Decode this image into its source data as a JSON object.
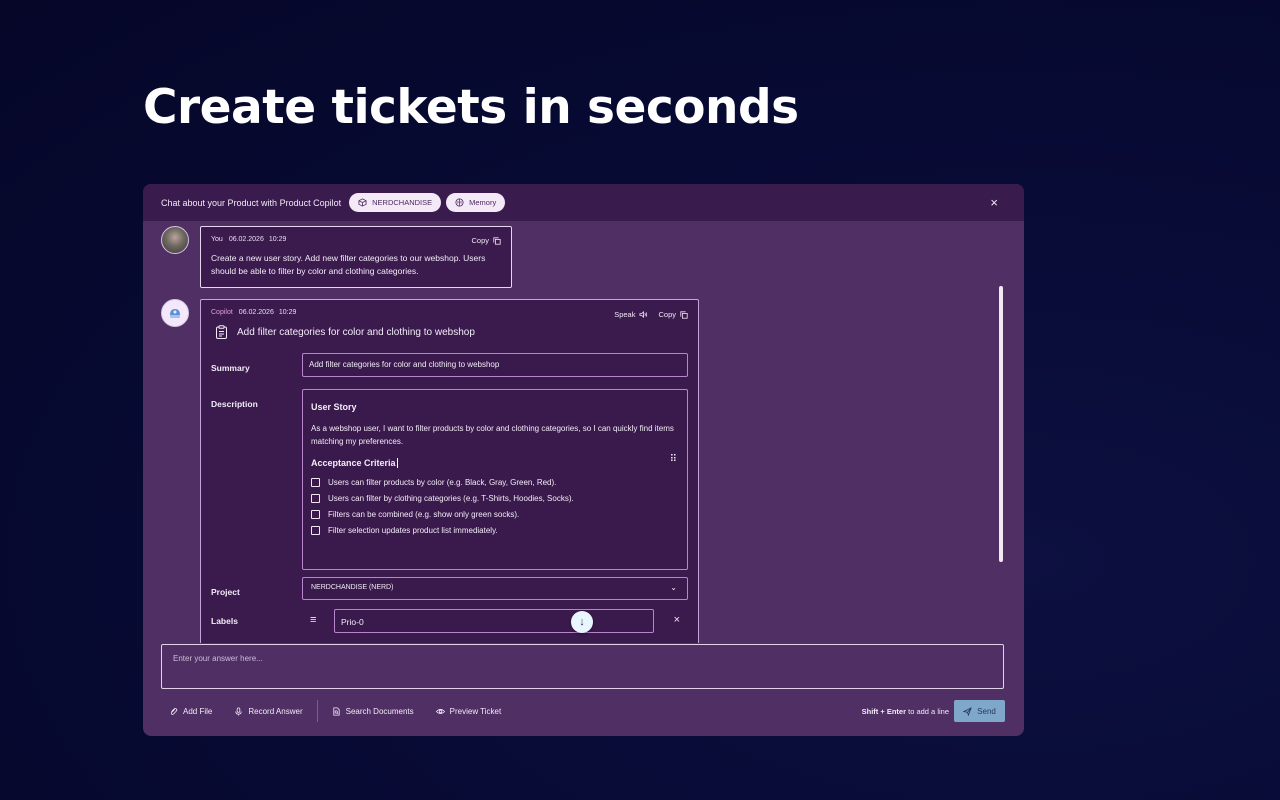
{
  "hero": {
    "title": "Create tickets in seconds"
  },
  "header": {
    "title": "Chat about your Product with Product Copilot",
    "pill_project": "NERDCHANDISE",
    "pill_memory": "Memory",
    "close": "×"
  },
  "user_message": {
    "author": "You",
    "date": "06.02.2026",
    "time": "10:29",
    "copy_label": "Copy",
    "text": "Create a new user story. Add new filter categories to our webshop. Users should be able to filter by color and clothing categories."
  },
  "bot_message": {
    "author": "Copilot",
    "date": "06.02.2026",
    "time": "10:29",
    "speak_label": "Speak",
    "copy_label": "Copy",
    "ticket_title": "Add filter categories for color and clothing to webshop",
    "fields": {
      "summary_label": "Summary",
      "summary_value": "Add filter categories for color and clothing to webshop",
      "description_label": "Description",
      "description": {
        "heading": "User Story",
        "story": "As a webshop user, I want to filter products by color and clothing categories, so I can quickly find items matching my preferences.",
        "criteria_heading": "Acceptance Criteria",
        "criteria": [
          "Users can filter products by color (e.g. Black, Gray, Green, Red).",
          "Users can filter by clothing categories (e.g. T-Shirts, Hoodies, Socks).",
          "Filters can be combined (e.g. show only green socks).",
          "Filter selection updates product list immediately."
        ]
      },
      "project_label": "Project",
      "project_value": "NERDCHANDISE (NERD)",
      "labels_label": "Labels",
      "labels_value": "Prio-0"
    }
  },
  "composer": {
    "placeholder": "Enter your answer here...",
    "tools": {
      "add_file": "Add File",
      "record_answer": "Record Answer",
      "search_documents": "Search Documents",
      "preview_ticket": "Preview Ticket"
    },
    "hint_keys": "Shift + Enter",
    "hint_text": "to add a line",
    "send_label": "Send"
  },
  "icons": [
    "box-icon",
    "brain-icon",
    "close-icon",
    "copy-icon",
    "speaker-icon",
    "clipboard-icon",
    "drag-handle-icon",
    "chevron-down-icon",
    "list-icon",
    "arrow-down-icon",
    "paperclip-icon",
    "microphone-icon",
    "document-search-icon",
    "eye-icon",
    "send-icon"
  ]
}
